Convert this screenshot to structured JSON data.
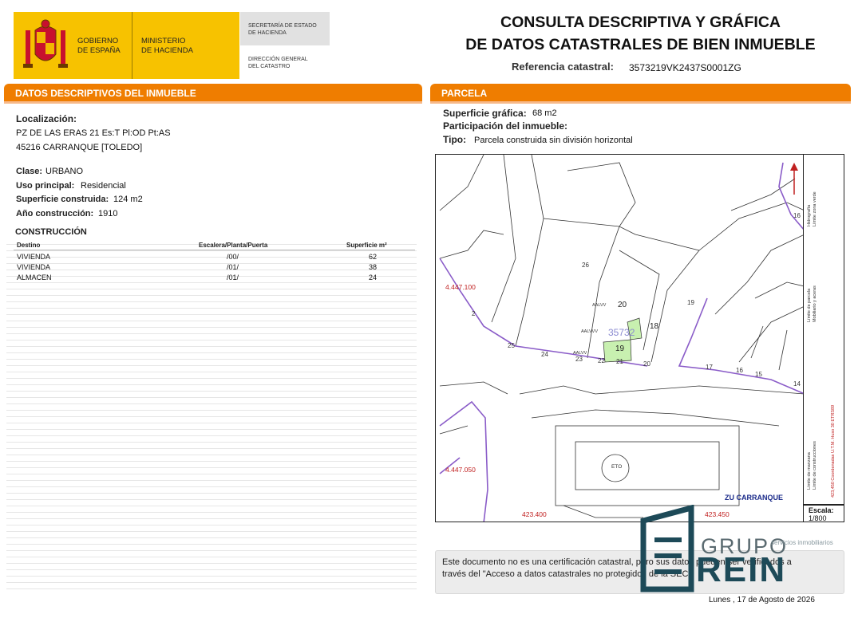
{
  "header": {
    "gov_line1": "GOBIERNO",
    "gov_line2": "DE ESPAÑA",
    "min_line1": "MINISTERIO",
    "min_line2": "DE HACIENDA",
    "sec_line1": "SECRETARÍA DE ESTADO",
    "sec_line2": "DE HACIENDA",
    "dir_line1": "DIRECCIÓN GENERAL",
    "dir_line2": "DEL CATASTRO",
    "title_line1": "CONSULTA DESCRIPTIVA Y GRÁFICA",
    "title_line2": "DE DATOS CATASTRALES DE BIEN INMUEBLE",
    "ref_label": "Referencia catastral:",
    "ref_value": "3573219VK2437S0001ZG"
  },
  "left": {
    "section_title": "DATOS DESCRIPTIVOS DEL INMUEBLE",
    "localizacion_label": "Localización:",
    "address_line1": "PZ DE LAS ERAS 21 Es:T Pl:OD Pt:AS",
    "address_line2": "45216 CARRANQUE [TOLEDO]",
    "clase_label": "Clase:",
    "clase_value": "URBANO",
    "uso_label": "Uso principal:",
    "uso_value": "Residencial",
    "sup_label": "Superficie construida:",
    "sup_value": "124 m2",
    "anio_label": "Año construcción:",
    "anio_value": "1910",
    "construccion_title": "CONSTRUCCIÓN",
    "table": {
      "headers": [
        "Destino",
        "Escalera/Planta/Puerta",
        "Superficie m²"
      ],
      "rows": [
        [
          "VIVIENDA",
          "/00/",
          "62"
        ],
        [
          "VIVIENDA",
          "/01/",
          "38"
        ],
        [
          "ALMACEN",
          "/01/",
          "24"
        ]
      ]
    }
  },
  "right": {
    "section_title": "PARCELA",
    "sup_grafica_label": "Superficie gráfica:",
    "sup_grafica_value": "68 m2",
    "participacion_label": "Participación del inmueble:",
    "tipo_label": "Tipo:",
    "tipo_value": "Parcela construida sin división horizontal"
  },
  "map": {
    "coord_y1": "4.447.100",
    "coord_y2": "4.447.050",
    "coord_x1": "423.400",
    "coord_x2": "423.450",
    "parcel_label": "35732",
    "zone_label": "ZU CARRANQUE",
    "plaza_label": "ETO",
    "numbers": [
      "20",
      "18",
      "19",
      "26",
      "25",
      "24",
      "23",
      "22",
      "21",
      "20",
      "17",
      "16",
      "15",
      "14",
      "19",
      "16",
      "2"
    ],
    "floor_codes": [
      "AALVV",
      "AALVVV",
      "AALVV"
    ],
    "highlight_color": "#c8f0b0",
    "boundary_color": "#8a5cc8"
  },
  "legend": {
    "col1_a": "Límite de manzana",
    "col1_b": "Límite de construcciones",
    "col2_a": "Límite de parcela",
    "col2_b": "Mobiliario y aceras",
    "col3_a": "Hidrografía",
    "col3_b": "Límite zona verde",
    "coords": "423,450 Coordenadas U.T.M. Huso 30 ETRS89",
    "scale_label": "Escala:",
    "scale_value": "1/800"
  },
  "footer": {
    "disclaimer_line1": "Este documento no es una certificación catastral, pero sus datos pueden ser verificados a",
    "disclaimer_line2": "través del \"Acceso a datos catastrales no protegidos de la SEC\"",
    "date": "Lunes , 17 de Agosto de 2026",
    "watermark_grupo": "GRUPO",
    "watermark_rein": "REIN",
    "watermark_tag": "servicios inmobiliarios"
  },
  "colors": {
    "orange": "#ef7d00",
    "yellow": "#f7c200",
    "watermark": "#1d4a58"
  }
}
